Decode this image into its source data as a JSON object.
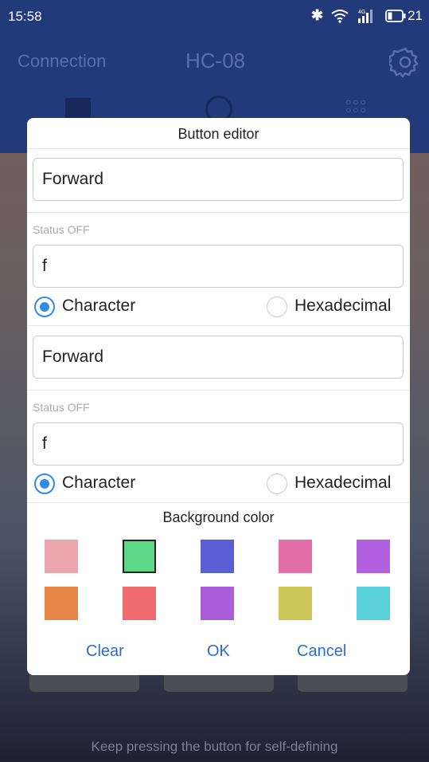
{
  "status_bar": {
    "time": "15:58",
    "battery": "21",
    "icons": [
      "bluetooth-icon",
      "wifi-icon",
      "signal-icon",
      "battery-icon"
    ],
    "signal_label": "4G"
  },
  "header": {
    "connection_label": "Connection",
    "device_name": "HC-08",
    "settings_icon": "gear-icon",
    "color": "#233a7a"
  },
  "tabs": [
    {
      "icon": "keypad-square-icon"
    },
    {
      "icon": "circle-icon"
    },
    {
      "icon": "grid-dots-icon"
    }
  ],
  "dialog": {
    "title": "Button editor",
    "sections": [
      {
        "name_value": "Forward",
        "status_label": "Status OFF",
        "command_value": "f",
        "radio": {
          "option_a": "Character",
          "option_b": "Hexadecimal",
          "selected": "Character"
        }
      },
      {
        "name_value": "Forward",
        "status_label": "Status OFF",
        "command_value": "f",
        "radio": {
          "option_a": "Character",
          "option_b": "Hexadecimal",
          "selected": "Character"
        }
      }
    ],
    "background_color_title": "Background color",
    "colors": [
      "#eba6ad",
      "#5dd788",
      "#5a60d4",
      "#e46ea8",
      "#b25fe0",
      "#e68545",
      "#ee6b6e",
      "#ab5cd9",
      "#cfc65a",
      "#58cfd9"
    ],
    "selected_color": "#5dd788",
    "buttons": {
      "clear": "Clear",
      "ok": "OK",
      "cancel": "Cancel"
    },
    "accent": "#2f8ce6"
  },
  "hint": "Keep pressing the button for self-defining"
}
